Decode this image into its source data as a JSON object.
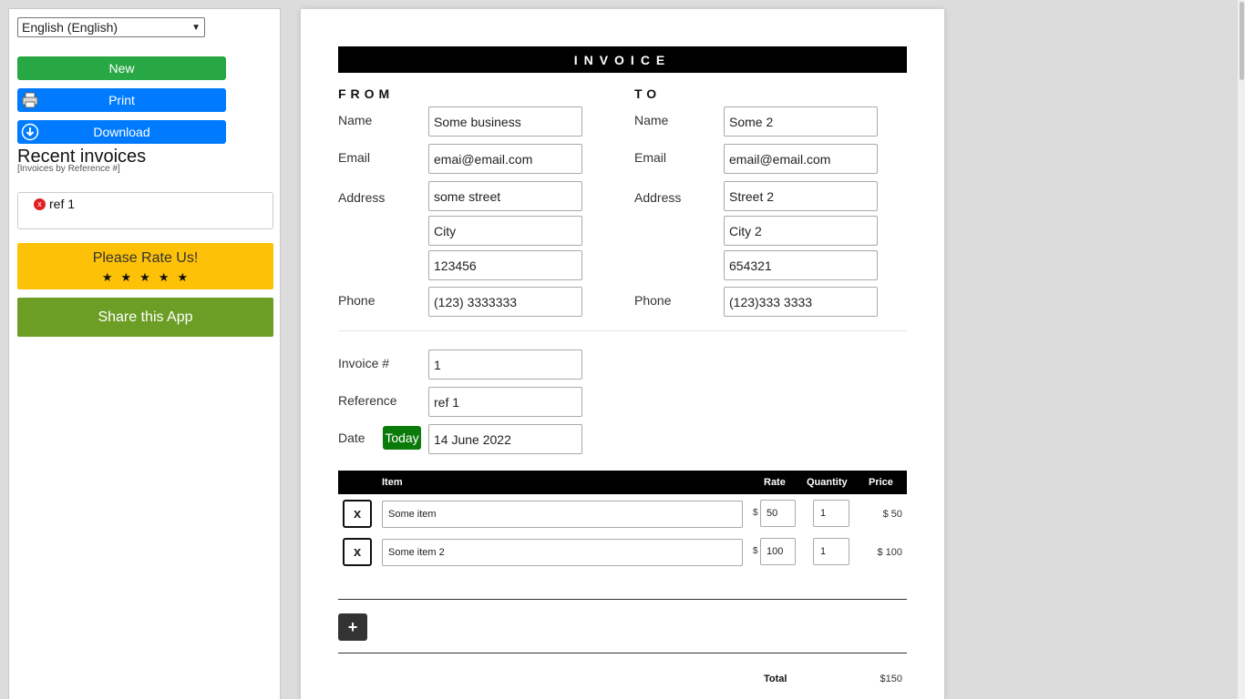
{
  "sidebar": {
    "language": "English (English)",
    "new_label": "New",
    "print_label": "Print",
    "download_label": "Download",
    "recent_title": "Recent invoices",
    "recent_subtitle": "[Invoices by Reference #]",
    "recent_items": [
      {
        "label": "ref 1"
      }
    ],
    "rate_label": "Please Rate Us!",
    "stars": "★★★★★",
    "share_label": "Share this App",
    "colors": {
      "new": "#28a745",
      "print": "#007bff",
      "rate": "#fdc107",
      "share": "#6c9e26"
    }
  },
  "invoice": {
    "title": "INVOICE",
    "from": {
      "heading": "FROM",
      "name_label": "Name",
      "name": "Some business",
      "email_label": "Email",
      "email": "emai@email.com",
      "address_label": "Address",
      "street": "some street",
      "city": "City",
      "zip": "123456",
      "phone_label": "Phone",
      "phone": "(123) 3333333"
    },
    "to": {
      "heading": "TO",
      "name_label": "Name",
      "name": "Some 2",
      "email_label": "Email",
      "email": "email@email.com",
      "address_label": "Address",
      "street": "Street 2",
      "city": "City 2",
      "zip": "654321",
      "phone_label": "Phone",
      "phone": "(123)333 3333"
    },
    "meta": {
      "number_label": "Invoice #",
      "number": "1",
      "reference_label": "Reference",
      "reference": "ref 1",
      "date_label": "Date",
      "today_label": "Today",
      "date": "14 June 2022"
    },
    "items_header": {
      "item": "Item",
      "rate": "Rate",
      "quantity": "Quantity",
      "price": "Price"
    },
    "items": [
      {
        "remove": "x",
        "item": "Some item",
        "currency": "$",
        "rate": "50",
        "quantity": "1",
        "price": "$ 50"
      },
      {
        "remove": "x",
        "item": "Some item 2",
        "currency": "$",
        "rate": "100",
        "quantity": "1",
        "price": "$ 100"
      }
    ],
    "add_label": "+",
    "total_label": "Total",
    "total": "$150"
  }
}
